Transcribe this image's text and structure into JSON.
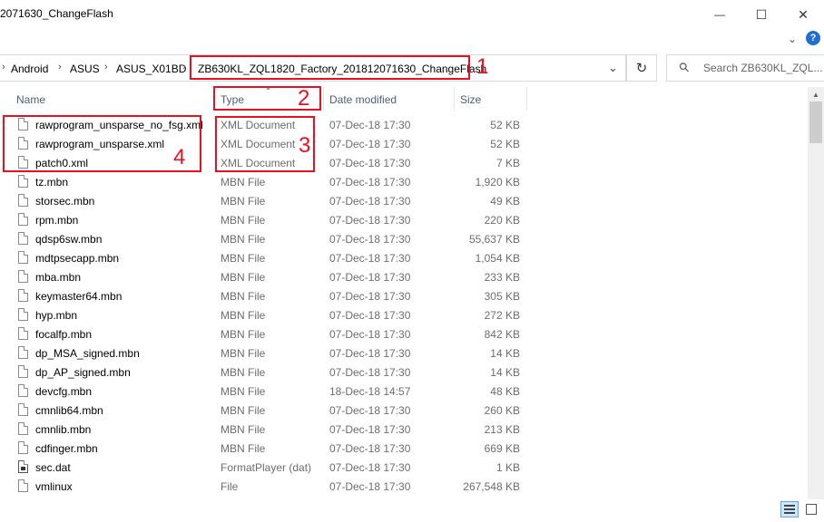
{
  "window": {
    "title": "2071630_ChangeFlash",
    "minimize": "—",
    "maximize": "☐",
    "close": "✕",
    "expand_ribbon": "⌄",
    "help": "?"
  },
  "address": {
    "crumbs": [
      "Android",
      "ASUS",
      "ASUS_X01BD",
      "ZB630KL_ZQL1820_Factory_201812071630_ChangeFlash"
    ],
    "separator": "›",
    "dropdown": "⌄",
    "refresh": "↻"
  },
  "search": {
    "icon": "⚲",
    "placeholder": "Search ZB630KL_ZQL..."
  },
  "columns": {
    "name": "Name",
    "type": "Type",
    "date": "Date modified",
    "size": "Size"
  },
  "files": [
    {
      "name": "rawprogram_unsparse_no_fsg.xml",
      "type": "XML Document",
      "date": "07-Dec-18 17:30",
      "size": "52 KB",
      "icon": "file-icon"
    },
    {
      "name": "rawprogram_unsparse.xml",
      "type": "XML Document",
      "date": "07-Dec-18 17:30",
      "size": "52 KB",
      "icon": "file-icon"
    },
    {
      "name": "patch0.xml",
      "type": "XML Document",
      "date": "07-Dec-18 17:30",
      "size": "7 KB",
      "icon": "file-icon"
    },
    {
      "name": "tz.mbn",
      "type": "MBN File",
      "date": "07-Dec-18 17:30",
      "size": "1,920 KB",
      "icon": "file-icon"
    },
    {
      "name": "storsec.mbn",
      "type": "MBN File",
      "date": "07-Dec-18 17:30",
      "size": "49 KB",
      "icon": "file-icon"
    },
    {
      "name": "rpm.mbn",
      "type": "MBN File",
      "date": "07-Dec-18 17:30",
      "size": "220 KB",
      "icon": "file-icon"
    },
    {
      "name": "qdsp6sw.mbn",
      "type": "MBN File",
      "date": "07-Dec-18 17:30",
      "size": "55,637 KB",
      "icon": "file-icon"
    },
    {
      "name": "mdtpsecapp.mbn",
      "type": "MBN File",
      "date": "07-Dec-18 17:30",
      "size": "1,054 KB",
      "icon": "file-icon"
    },
    {
      "name": "mba.mbn",
      "type": "MBN File",
      "date": "07-Dec-18 17:30",
      "size": "233 KB",
      "icon": "file-icon"
    },
    {
      "name": "keymaster64.mbn",
      "type": "MBN File",
      "date": "07-Dec-18 17:30",
      "size": "305 KB",
      "icon": "file-icon"
    },
    {
      "name": "hyp.mbn",
      "type": "MBN File",
      "date": "07-Dec-18 17:30",
      "size": "272 KB",
      "icon": "file-icon"
    },
    {
      "name": "focalfp.mbn",
      "type": "MBN File",
      "date": "07-Dec-18 17:30",
      "size": "842 KB",
      "icon": "file-icon"
    },
    {
      "name": "dp_MSA_signed.mbn",
      "type": "MBN File",
      "date": "07-Dec-18 17:30",
      "size": "14 KB",
      "icon": "file-icon"
    },
    {
      "name": "dp_AP_signed.mbn",
      "type": "MBN File",
      "date": "07-Dec-18 17:30",
      "size": "14 KB",
      "icon": "file-icon"
    },
    {
      "name": "devcfg.mbn",
      "type": "MBN File",
      "date": "18-Dec-18 14:57",
      "size": "48 KB",
      "icon": "file-icon"
    },
    {
      "name": "cmnlib64.mbn",
      "type": "MBN File",
      "date": "07-Dec-18 17:30",
      "size": "260 KB",
      "icon": "file-icon"
    },
    {
      "name": "cmnlib.mbn",
      "type": "MBN File",
      "date": "07-Dec-18 17:30",
      "size": "213 KB",
      "icon": "file-icon"
    },
    {
      "name": "cdfinger.mbn",
      "type": "MBN File",
      "date": "07-Dec-18 17:30",
      "size": "669 KB",
      "icon": "file-icon"
    },
    {
      "name": "sec.dat",
      "type": "FormatPlayer (dat)",
      "date": "07-Dec-18 17:30",
      "size": "1 KB",
      "icon": "dat-file-icon"
    },
    {
      "name": "vmlinux",
      "type": "File",
      "date": "07-Dec-18 17:30",
      "size": "267,548 KB",
      "icon": "file-icon"
    }
  ],
  "annotations": [
    "1",
    "2",
    "3",
    "4"
  ],
  "colors": {
    "annotation": "#e81123",
    "column_header": "#4c607a",
    "secondary_text": "#6d6d6d"
  }
}
